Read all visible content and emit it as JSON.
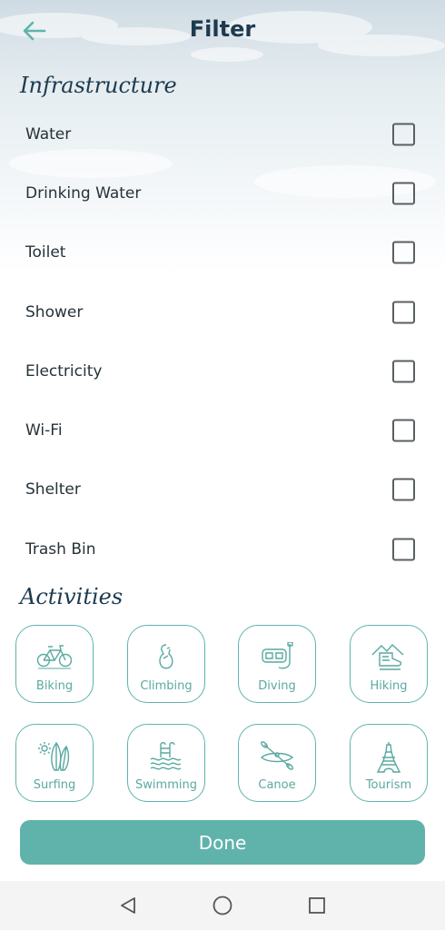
{
  "header": {
    "title": "Filter",
    "back_icon": "arrow-left-icon"
  },
  "colors": {
    "accent": "#5fb3ab",
    "heading": "#1d3a4f",
    "text": "#263238"
  },
  "infrastructure": {
    "title": "Infrastructure",
    "items": [
      {
        "label": "Water",
        "checked": false
      },
      {
        "label": "Drinking Water",
        "checked": false
      },
      {
        "label": "Toilet",
        "checked": false
      },
      {
        "label": "Shower",
        "checked": false
      },
      {
        "label": "Electricity",
        "checked": false
      },
      {
        "label": "Wi-Fi",
        "checked": false
      },
      {
        "label": "Shelter",
        "checked": false
      },
      {
        "label": "Trash Bin",
        "checked": false
      }
    ]
  },
  "activities": {
    "title": "Activities",
    "items": [
      {
        "label": "Biking",
        "icon": "bicycle-icon"
      },
      {
        "label": "Climbing",
        "icon": "carabiner-icon"
      },
      {
        "label": "Diving",
        "icon": "diving-mask-icon"
      },
      {
        "label": "Hiking",
        "icon": "hiking-boot-icon"
      },
      {
        "label": "Surfing",
        "icon": "surfboard-icon"
      },
      {
        "label": "Swimming",
        "icon": "swimming-pool-icon"
      },
      {
        "label": "Canoe",
        "icon": "canoe-icon"
      },
      {
        "label": "Tourism",
        "icon": "eiffel-tower-icon"
      }
    ]
  },
  "done_label": "Done",
  "system_nav": {
    "back_icon": "triangle-back-icon",
    "home_icon": "circle-home-icon",
    "recents_icon": "square-recents-icon"
  }
}
